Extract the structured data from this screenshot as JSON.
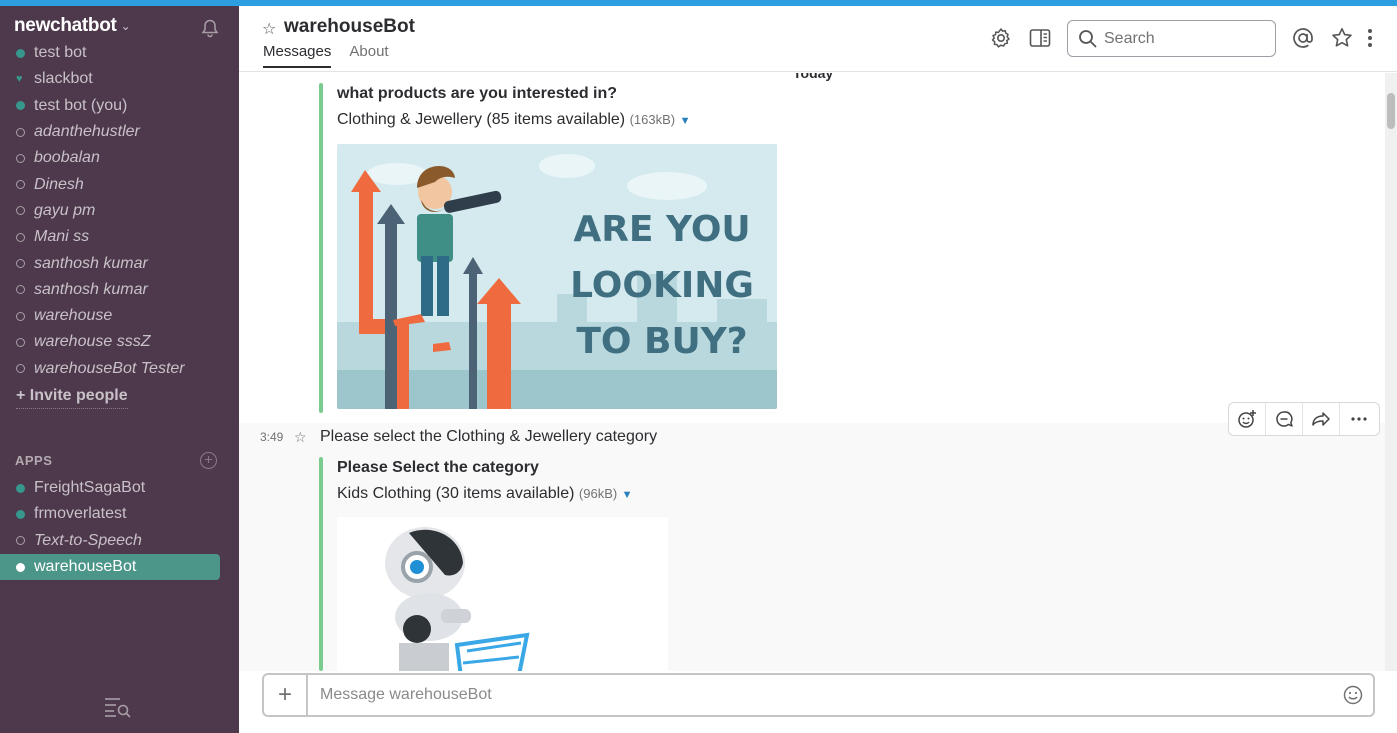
{
  "team": {
    "name": "newchatbot"
  },
  "direct_messages": [
    {
      "label": "test bot",
      "status": "online"
    },
    {
      "label": "slackbot",
      "status": "heart"
    },
    {
      "label": "test bot (you)",
      "status": "online"
    },
    {
      "label": "adanthehustler",
      "status": "away"
    },
    {
      "label": "boobalan",
      "status": "away"
    },
    {
      "label": "Dinesh",
      "status": "away"
    },
    {
      "label": "gayu pm",
      "status": "away"
    },
    {
      "label": "Mani ss",
      "status": "away"
    },
    {
      "label": "santhosh kumar",
      "status": "away"
    },
    {
      "label": "santhosh kumar",
      "status": "away"
    },
    {
      "label": "warehouse",
      "status": "away"
    },
    {
      "label": "warehouse sssZ",
      "status": "away"
    },
    {
      "label": "warehouseBot Tester",
      "status": "away"
    }
  ],
  "invite": {
    "label": "+ Invite people"
  },
  "apps": {
    "header": "APPS",
    "items": [
      {
        "label": "FreightSagaBot",
        "status": "online"
      },
      {
        "label": "frmoverlatest",
        "status": "online"
      },
      {
        "label": "Text-to-Speech",
        "status": "away"
      },
      {
        "label": "warehouseBot",
        "status": "active"
      }
    ]
  },
  "channel": {
    "title": "warehouseBot",
    "tabs": [
      {
        "label": "Messages",
        "active": true
      },
      {
        "label": "About",
        "active": false
      }
    ]
  },
  "search": {
    "placeholder": "Search"
  },
  "messages": {
    "day_divider": "Today",
    "attachment1": {
      "title": "what products are you interested in?",
      "file_name": "Clothing & Jewellery (85 items available)",
      "file_size": "(163kB)",
      "image_text": [
        "ARE YOU",
        "LOOKING",
        "TO BUY?"
      ]
    },
    "message2": {
      "time": "3:49",
      "text": "Please select  the Clothing & Jewellery category"
    },
    "attachment2": {
      "title": "Please Select the category",
      "file_name": "Kids Clothing (30 items available)",
      "file_size": "(96kB)"
    }
  },
  "composer": {
    "placeholder": "Message warehouseBot"
  },
  "colors": {
    "sidebar_bg": "#4d394b",
    "active_item": "#4c9689",
    "online_dot": "#38978d",
    "attachment_bar": "#7ccb8e",
    "top_bar": "#2d9ee0"
  }
}
